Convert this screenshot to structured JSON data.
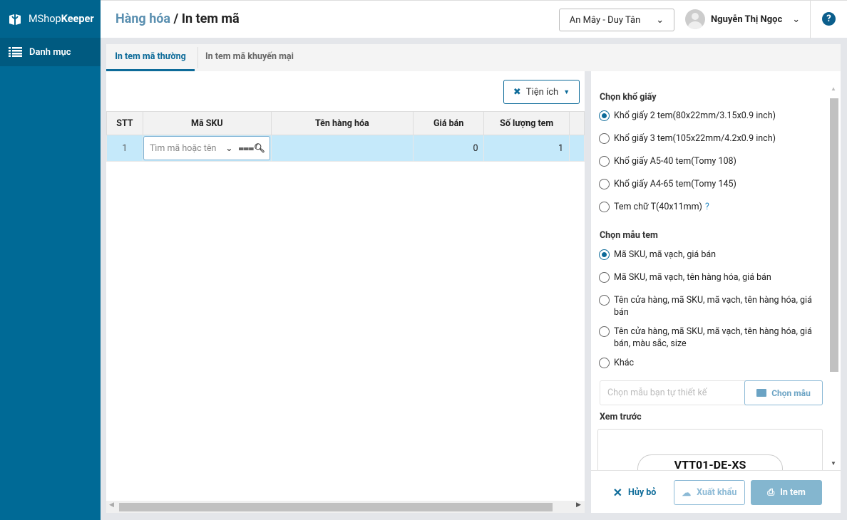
{
  "app": {
    "logo_light": "MShop",
    "logo_bold": "Keeper"
  },
  "sidebar": {
    "items": [
      {
        "label": "Danh mục"
      }
    ]
  },
  "header": {
    "breadcrumb_parent": "Hàng hóa",
    "breadcrumb_sep": " / ",
    "title": "In tem mã",
    "store": "An Mây - Duy Tân",
    "user": "Nguyễn Thị Ngọc",
    "help": "?"
  },
  "tabs": [
    {
      "label": "In tem mã thường",
      "active": true
    },
    {
      "label": "In tem mã khuyến mại",
      "active": false
    }
  ],
  "toolbar": {
    "utilities_label": "Tiện ích"
  },
  "table": {
    "columns": [
      "STT",
      "Mã SKU",
      "Tên hàng hóa",
      "Giá bán",
      "Số lượng tem"
    ],
    "rows": [
      {
        "stt": "1",
        "sku_placeholder": "Tìm mã hoặc tên",
        "name": "",
        "price": "0",
        "qty": "1"
      }
    ]
  },
  "paper": {
    "heading": "Chọn khổ giấy",
    "options": [
      "Khổ giấy 2 tem(80x22mm/3.15x0.9 inch)",
      "Khổ giấy 3 tem(105x22mm/4.2x0.9 inch)",
      "Khổ giấy A5-40 tem(Tomy 108)",
      "Khổ giấy A4-65 tem(Tomy 145)",
      "Tem chữ T(40x11mm)"
    ],
    "selected": 0,
    "help": "?"
  },
  "template": {
    "heading": "Chọn mẫu tem",
    "options": [
      "Mã SKU, mã vạch, giá bán",
      "Mã SKU, mã vạch, tên hàng hóa, giá bán",
      "Tên cửa hàng, mã SKU, mã vạch, tên hàng hóa, giá bán",
      "Tên cửa hàng, mã SKU, mã vạch, tên hàng hóa, giá bán, màu sắc, size",
      "Khác"
    ],
    "selected": 0,
    "custom_placeholder": "Chọn mẫu bạn tự thiết kế",
    "choose_label": "Chọn mẫu"
  },
  "preview": {
    "heading": "Xem trước",
    "sku": "VTT01-DE-XS"
  },
  "footer": {
    "cancel": "Hủy bỏ",
    "export": "Xuất khẩu",
    "print": "In tem"
  },
  "colors": {
    "sidebar": "#006a96",
    "accent": "#0d6b99",
    "row_selected": "#c5e9fa"
  }
}
